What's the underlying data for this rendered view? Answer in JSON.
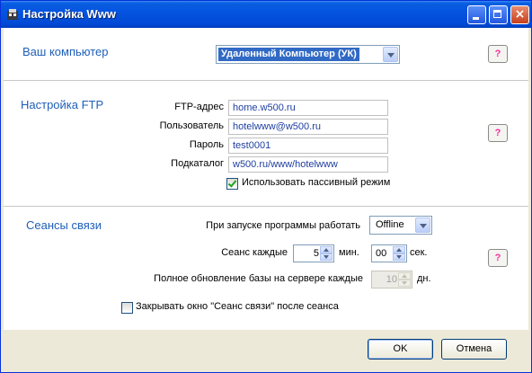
{
  "window": {
    "title": "Настройка Www",
    "icon": "settings-app-icon",
    "controls": {
      "minimize": "minimize-icon",
      "maximize": "maximize-icon",
      "close": "×"
    }
  },
  "computer_section": {
    "title": "Ваш компьютер",
    "selected": "Удаленный Компьютер (УК)",
    "help_label": "?"
  },
  "ftp_section": {
    "title": "Настройка FTP",
    "fields": [
      {
        "label": "FTP-адрес",
        "value": "home.w500.ru"
      },
      {
        "label": "Пользователь",
        "value": "hotelwww@w500.ru"
      },
      {
        "label": "Пароль",
        "value": "test0001"
      },
      {
        "label": "Подкаталог",
        "value": "w500.ru/www/hotelwww"
      }
    ],
    "passive_mode": {
      "label": "Использовать пассивный режим",
      "checked": true
    },
    "help_label": "?"
  },
  "session_section": {
    "title": "Сеансы связи",
    "startup_label": "При запуске программы работать",
    "startup_value": "Offline",
    "session_label": "Сеанс каждые",
    "minutes": "5",
    "min_unit": "мин.",
    "seconds": "00",
    "sec_unit": "сек.",
    "full_update_label": "Полное обновление базы на сервере каждые",
    "full_update_value": "10",
    "day_unit": "дн.",
    "close_window": {
      "label": "Закрывать окно \"Сеанс связи\" после сеанса",
      "checked": false
    },
    "help_label": "?"
  },
  "footer": {
    "ok_label": "OK",
    "cancel_label": "Отмена"
  }
}
